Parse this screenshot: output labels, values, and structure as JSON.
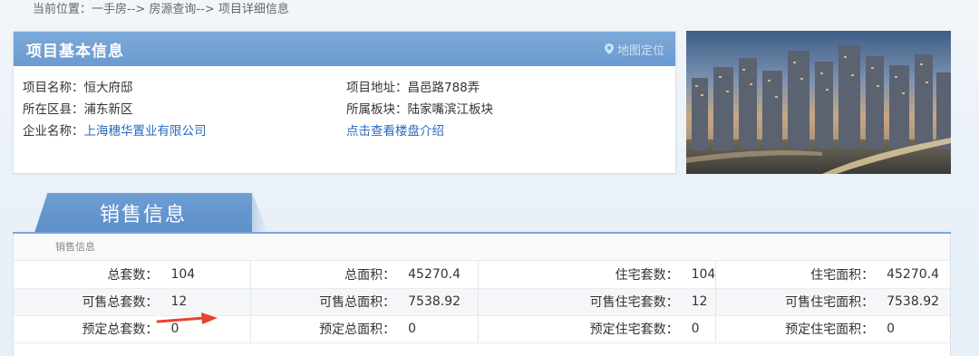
{
  "breadcrumb": "当前位置：一手房--> 房源查询--> 项目详细信息",
  "basic_info": {
    "title": "项目基本信息",
    "map_link": "地图定位",
    "left": [
      {
        "label": "项目名称：",
        "value": "恒大府邸"
      },
      {
        "label": "所在区县：",
        "value": "浦东新区"
      },
      {
        "label": "企业名称：",
        "value": "上海穗华置业有限公司"
      }
    ],
    "right": [
      {
        "label": "项目地址：",
        "value": "昌邑路788弄"
      },
      {
        "label": "所属板块：",
        "value": "陆家嘴滨江板块"
      },
      {
        "link": "点击查看楼盘介绍"
      }
    ]
  },
  "sales": {
    "tab_label": "销售信息",
    "sub_label": "销售信息",
    "rows": [
      [
        {
          "label": "总套数：",
          "value": "104"
        },
        {
          "label": "总面积：",
          "value": "45270.4"
        },
        {
          "label": "住宅套数：",
          "value": "104"
        },
        {
          "label": "住宅面积：",
          "value": "45270.4"
        }
      ],
      [
        {
          "label": "可售总套数：",
          "value": "12"
        },
        {
          "label": "可售总面积：",
          "value": "7538.92"
        },
        {
          "label": "可售住宅套数：",
          "value": "12"
        },
        {
          "label": "可售住宅面积：",
          "value": "7538.92"
        }
      ],
      [
        {
          "label": "预定总套数：",
          "value": "0"
        },
        {
          "label": "预定总面积：",
          "value": "0"
        },
        {
          "label": "预定住宅套数：",
          "value": "0"
        },
        {
          "label": "预定住宅面积：",
          "value": "0"
        }
      ]
    ]
  },
  "colors": {
    "header_blue": "#6a9ad0",
    "link_blue": "#2a6bbd",
    "arrow_red": "#e8432e"
  },
  "icons": {
    "map_pin": "map-pin-icon",
    "annotation_arrow": "red-arrow-icon"
  }
}
